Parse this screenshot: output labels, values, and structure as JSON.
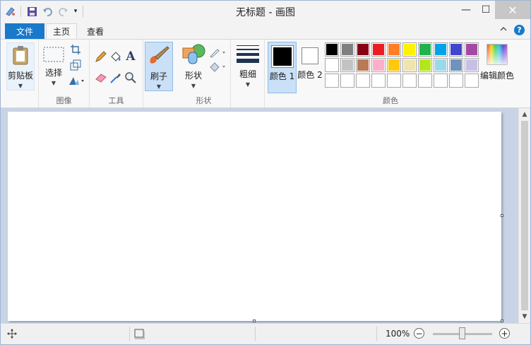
{
  "window": {
    "title": "无标题 - 画图",
    "minimize_glyph": "—",
    "maximize_glyph": "☐",
    "close_glyph": "✕"
  },
  "quick_access": {
    "icons": [
      "paint-app-icon",
      "save-icon",
      "undo-icon",
      "redo-icon",
      "customize-dropdown-icon"
    ]
  },
  "tabs": {
    "file": "文件",
    "home": "主页",
    "view": "查看",
    "help_glyph": "?"
  },
  "ribbon": {
    "clipboard": {
      "label": "剪贴板"
    },
    "image": {
      "group_label": "图像",
      "select_label": "选择"
    },
    "tools": {
      "group_label": "工具"
    },
    "brush": {
      "label": "刷子"
    },
    "shapes": {
      "group_label": "形状",
      "shapes_label": "形状"
    },
    "size": {
      "label": "粗细"
    },
    "colors": {
      "group_label": "颜色",
      "color1_label": "颜色 1",
      "color2_label": "颜色 2",
      "color1": "#000000",
      "color2": "#ffffff",
      "edit_label": "编辑颜色",
      "palette_row1": [
        "#000000",
        "#7f7f7f",
        "#880015",
        "#ed1c24",
        "#ff7f27",
        "#fff200",
        "#22b14c",
        "#00a2e8",
        "#3f48cc",
        "#a349a4"
      ],
      "palette_row2": [
        "#ffffff",
        "#c3c3c3",
        "#b97a57",
        "#ffaec9",
        "#ffc90e",
        "#efe4b0",
        "#b5e61d",
        "#99d9ea",
        "#7092be",
        "#c8bfe7"
      ]
    }
  },
  "status": {
    "zoom": "100%",
    "zoom_minus_glyph": "−",
    "zoom_plus_glyph": "+"
  }
}
